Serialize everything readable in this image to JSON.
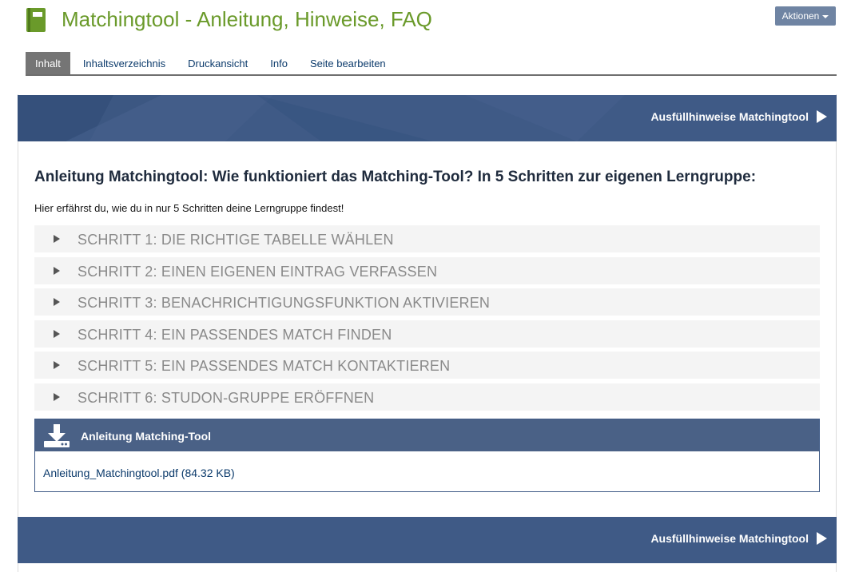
{
  "header": {
    "title": "Matchingtool - Anleitung, Hinweise, FAQ",
    "icon": "book-icon",
    "actions_label": "Aktionen"
  },
  "tabs": [
    {
      "label": "Inhalt",
      "active": true
    },
    {
      "label": "Inhaltsverzeichnis",
      "active": false
    },
    {
      "label": "Druckansicht",
      "active": false
    },
    {
      "label": "Info",
      "active": false
    },
    {
      "label": "Seite bearbeiten",
      "active": false
    }
  ],
  "banner": {
    "link_label": "Ausfüllhinweise Matchingtool",
    "icon": "play-icon",
    "color": "#3f5a86"
  },
  "main": {
    "heading": "Anleitung Matchingtool: Wie funktioniert das Matching-Tool? In 5 Schritten zur eigenen Lerngruppe:",
    "intro": "Hier erfährst du, wie du in nur 5 Schritten deine Lerngruppe findest!",
    "steps": [
      "Schritt 1: Die richtige Tabelle wählen",
      "Schritt 2: Einen eigenen Eintrag verfassen",
      "Schritt 3: Benachrichtigungsfunktion aktivieren",
      "Schritt 4: Ein passendes Match finden",
      "Schritt 5: Ein passendes Match kontaktieren",
      "Schritt 6: StudOn-Gruppe eröffnen"
    ]
  },
  "download": {
    "title": "Anleitung Matching-Tool",
    "icon": "download-icon",
    "file_label": "Anleitung_Matchingtool.pdf (84.32 KB)"
  },
  "colors": {
    "title_green": "#6a9a2a",
    "banner_blue": "#3f5a86",
    "actions_button": "#6f84a3",
    "link_blue": "#0b3a6b"
  }
}
